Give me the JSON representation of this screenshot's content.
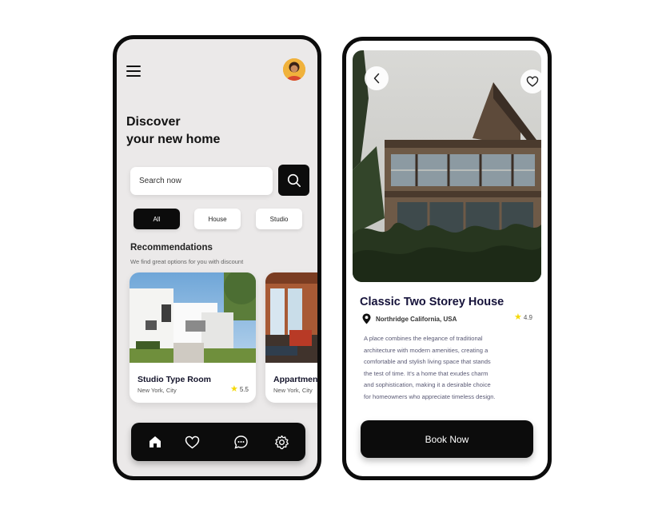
{
  "left_screen": {
    "headline_line1": "Discover",
    "headline_line2": "your new home",
    "search": {
      "placeholder": "Search now"
    },
    "filters": [
      {
        "label": "All",
        "active": true
      },
      {
        "label": "House",
        "active": false
      },
      {
        "label": "Studio",
        "active": false
      }
    ],
    "recommendations": {
      "title": "Recommendations",
      "subtitle": "We find great options for you with discount"
    },
    "cards": [
      {
        "title": "Studio Type Room",
        "location": "New York, City",
        "rating": "5.5"
      },
      {
        "title": "Appartment",
        "location": "New York, City"
      }
    ],
    "bottom_nav": {
      "icons": [
        "home-icon",
        "heart-icon",
        "chat-icon",
        "settings-icon"
      ]
    }
  },
  "right_screen": {
    "title": "Classic Two Storey House",
    "location": "Northridge California, USA",
    "rating": "4.9",
    "description_lines": [
      "A place combines the elegance of traditional",
      "architecture with modern amenities, creating a",
      "comfortable and stylish living space that stands",
      "the test of time. It's a home that exudes charm",
      "and sophistication, making it a desirable choice",
      "for homeowners who appreciate timeless design."
    ],
    "cta_label": "Book Now"
  },
  "colors": {
    "primary": "#0c0c0c",
    "star": "#f5d90a",
    "title_text": "#15123a",
    "screen_bg": "#ebe9e9"
  }
}
